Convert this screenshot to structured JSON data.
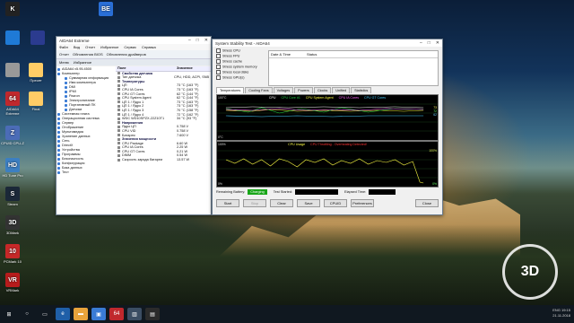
{
  "desktop_icons": [
    {
      "label": "",
      "glyph": "K",
      "color": "#222222",
      "name": "k-app"
    },
    {
      "label": "",
      "glyph": "BE",
      "color": "#2a6fd6",
      "name": "be-app"
    },
    {
      "label": "",
      "glyph": "",
      "color": "#1f7ad6",
      "name": "this-pc"
    },
    {
      "label": "",
      "glyph": "",
      "color": "#2b3b8f",
      "name": "winrar"
    },
    {
      "label": "",
      "glyph": "",
      "color": "#999999",
      "name": "recycle"
    },
    {
      "label": "Пресет",
      "glyph": "",
      "color": "#ffcc66",
      "name": "folder"
    },
    {
      "label": "AIDA64 Extreme",
      "glyph": "64",
      "color": "#c0282d",
      "name": "aida64"
    },
    {
      "label": "Final",
      "glyph": "",
      "color": "#ffcc66",
      "name": "folder-final"
    },
    {
      "label": "CPUID CPU-Z",
      "glyph": "Z",
      "color": "#4b6cb7",
      "name": "cpuz"
    },
    {
      "label": "HD Tune Pro",
      "glyph": "HD",
      "color": "#3c7fc2",
      "name": "hdtune"
    },
    {
      "label": "Steam",
      "glyph": "S",
      "color": "#1b2838",
      "name": "steam"
    },
    {
      "label": "3DMark",
      "glyph": "3D",
      "color": "#333333",
      "name": "3dmark"
    },
    {
      "label": "PCMark 10",
      "glyph": "10",
      "color": "#c62828",
      "name": "pcmark10"
    },
    {
      "label": "VRMark",
      "glyph": "VR",
      "color": "#b71c1c",
      "name": "vrmark"
    }
  ],
  "aida": {
    "title": "AIDA64 Extreme",
    "menu": [
      "Файл",
      "Вид",
      "Отчет",
      "Избранное",
      "Сервис",
      "Справка"
    ],
    "toolbar": [
      "Отчет",
      "Обновления BIOS",
      "Обновления драйверов"
    ],
    "tabs": [
      "Меню",
      "Избранное"
    ],
    "tree": [
      {
        "label": "AIDA64 v5.95.4500",
        "sub": false
      },
      {
        "label": "Компьютер",
        "sub": false
      },
      {
        "label": "Суммарная информация",
        "sub": true
      },
      {
        "label": "Имя компьютера",
        "sub": true
      },
      {
        "label": "DMI",
        "sub": true
      },
      {
        "label": "IPMI",
        "sub": true
      },
      {
        "label": "Разгон",
        "sub": true
      },
      {
        "label": "Электропитание",
        "sub": true
      },
      {
        "label": "Портативный ПК",
        "sub": true
      },
      {
        "label": "Датчики",
        "sub": true
      },
      {
        "label": "Системная плата",
        "sub": false
      },
      {
        "label": "Операционная система",
        "sub": false
      },
      {
        "label": "Сервер",
        "sub": false
      },
      {
        "label": "Отображение",
        "sub": false
      },
      {
        "label": "Мультимедиа",
        "sub": false
      },
      {
        "label": "Хранение данных",
        "sub": false
      },
      {
        "label": "Сеть",
        "sub": false
      },
      {
        "label": "DirectX",
        "sub": false
      },
      {
        "label": "Устройства",
        "sub": false
      },
      {
        "label": "Программы",
        "sub": false
      },
      {
        "label": "Безопасность",
        "sub": false
      },
      {
        "label": "Конфигурация",
        "sub": false
      },
      {
        "label": "База данных",
        "sub": false
      },
      {
        "label": "Тест",
        "sub": false
      }
    ],
    "col_field": "Поле",
    "col_value": "Значение",
    "rows": [
      {
        "k": "Свойства датчика",
        "v": "",
        "group": true
      },
      {
        "k": "Тип датчика",
        "v": "CPU, HDD, ACPI, SNB",
        "group": false
      },
      {
        "k": "Температуры",
        "v": "",
        "group": true
      },
      {
        "k": "ЦП",
        "v": "73 °C  (163 °F)",
        "group": false
      },
      {
        "k": "CPU IA Cores",
        "v": "73 °C  (163 °F)",
        "group": false
      },
      {
        "k": "CPU GT Cores",
        "v": "62 °C  (144 °F)",
        "group": false
      },
      {
        "k": "CPU System Agent",
        "v": "62 °C  (144 °F)",
        "group": false
      },
      {
        "k": "ЦП 1 / Ядро 1",
        "v": "73 °C  (163 °F)",
        "group": false
      },
      {
        "k": "ЦП 1 / Ядро 2",
        "v": "73 °C  (163 °F)",
        "group": false
      },
      {
        "k": "ЦП 1 / Ядро 3",
        "v": "70 °C  (158 °F)",
        "group": false
      },
      {
        "k": "ЦП 1 / Ядро 4",
        "v": "72 °C  (162 °F)",
        "group": false
      },
      {
        "k": "WDC WD10SPZX-22Z10T1",
        "v": "34 °C  (93 °F)",
        "group": false
      },
      {
        "k": "Напряжения",
        "v": "",
        "group": true
      },
      {
        "k": "Ядро ЦП",
        "v": "0.758 V",
        "group": false
      },
      {
        "k": "CPU VID",
        "v": "0.758 V",
        "group": false
      },
      {
        "k": "Батарея",
        "v": "7.600 V",
        "group": false
      },
      {
        "k": "Значения мощности",
        "v": "",
        "group": true
      },
      {
        "k": "CPU Package",
        "v": "6.60 W",
        "group": false
      },
      {
        "k": "CPU IA Cores",
        "v": "2.25 W",
        "group": false
      },
      {
        "k": "CPU GT Cores",
        "v": "0.21 W",
        "group": false
      },
      {
        "k": "DIMM",
        "v": "0.54 W",
        "group": false
      },
      {
        "k": "Скорость заряда батареи",
        "v": "13.57 W",
        "group": false
      }
    ]
  },
  "sst": {
    "title": "System Stability Test - AIDA64",
    "checks": [
      "Stress CPU",
      "Stress FPU",
      "Stress cache",
      "Stress system memory",
      "Stress local disks",
      "Stress GPU(s)"
    ],
    "col_datetime": "Date & Time",
    "col_status": "Status",
    "tabs": [
      "Temperatures",
      "Cooling Fans",
      "Voltages",
      "Powers",
      "Clocks",
      "Unified",
      "Statistics"
    ],
    "legend_temp": [
      {
        "label": "CPU",
        "color": "#ffffff"
      },
      {
        "label": "CPU Core #1",
        "color": "#22cc44"
      },
      {
        "label": "CPU System Agent",
        "color": "#ffff44"
      },
      {
        "label": "CPU IA Cores",
        "color": "#ff66ff"
      },
      {
        "label": "CPU GT Cores",
        "color": "#44ccff"
      }
    ],
    "legend_usage": [
      {
        "label": "CPU Usage",
        "color": "#ffff44"
      },
      {
        "label": "CPU Throttling - Overheating Detected!",
        "color": "#ff3333"
      }
    ],
    "temp_axis": [
      "100°C",
      "0°C"
    ],
    "temp_right": [
      "73",
      "72",
      "62"
    ],
    "usage_axis": [
      "100%",
      "0%"
    ],
    "usage_right": [
      "100%",
      "0%"
    ],
    "remaining_battery_label": "Remaining Battery:",
    "remaining_battery_value": "Charging",
    "test_started_label": "Test Started:",
    "elapsed_label": "Elapsed Time:",
    "buttons": [
      "Start",
      "Stop",
      "Clear",
      "Save",
      "CPUID",
      "Preferences",
      "Close"
    ]
  },
  "taskbar": {
    "time": "19:15",
    "date": "21.11.2018",
    "lang": "ENG"
  },
  "watermark": "3DNews"
}
